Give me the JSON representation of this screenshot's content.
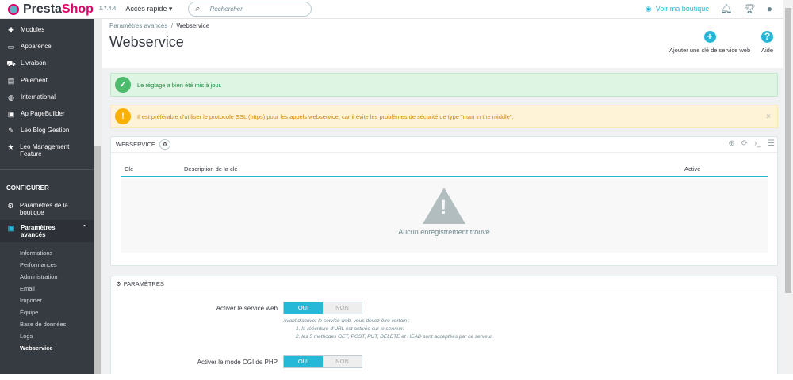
{
  "topbar": {
    "brand_a": "Presta",
    "brand_b": "Shop",
    "version": "1.7.4.4",
    "quick_access": "Accès rapide ▾",
    "search_placeholder": "Rechercher",
    "view_shop": "Voir ma boutique"
  },
  "sidebar": {
    "items": [
      {
        "icon": "✚",
        "label": "Modules"
      },
      {
        "icon": "▭",
        "label": "Apparence"
      },
      {
        "icon": "⛟",
        "label": "Livraison"
      },
      {
        "icon": "▤",
        "label": "Paiement"
      },
      {
        "icon": "◍",
        "label": "International"
      },
      {
        "icon": "▣",
        "label": "Ap PageBuilder"
      },
      {
        "icon": "✎",
        "label": "Leo Blog Gestion"
      },
      {
        "icon": "★",
        "label": "Leo Management Feature"
      }
    ],
    "section": "CONFIGURER",
    "config_items": [
      {
        "icon": "⚙",
        "label": "Paramètres de la boutique"
      },
      {
        "icon": "▣",
        "label": "Paramètres avancés"
      }
    ],
    "sub_items": [
      "Informations",
      "Performances",
      "Administration",
      "Email",
      "Importer",
      "Équipe",
      "Base de données",
      "Logs",
      "Webservice"
    ]
  },
  "header": {
    "breadcrumb_parent": "Paramètres avancés",
    "breadcrumb_sep": "/",
    "breadcrumb_current": "Webservice",
    "title": "Webservice",
    "add_key": "Ajouter une clé de service web",
    "help": "Aide"
  },
  "alerts": {
    "success": "Le réglage a bien été mis à jour.",
    "warning": "Il est préférable d'utiliser le protocole SSL (https) pour les appels webservice, car il évite les problèmes de sécurité de type \"man in the middle\"."
  },
  "table": {
    "title": "WEBSERVICE",
    "count": "0",
    "columns": [
      "Clé",
      "Description de la clé",
      "Activé"
    ],
    "empty": "Aucun enregistrement trouvé"
  },
  "params": {
    "title": "PARAMÈTRES",
    "fields": [
      {
        "label": "Activer le service web",
        "yes": "OUI",
        "no": "NON",
        "value": "OUI",
        "help": [
          "Avant d'activer le service web, vous devez être certain :",
          "1. la réécriture d'URL est activée sur le serveur.",
          "2. les 5 méthodes GET, POST, PUT, DELETE et HEAD sont acceptées par ce serveur."
        ]
      },
      {
        "label": "Activer le mode CGI de PHP",
        "yes": "OUI",
        "no": "NON",
        "value": "OUI"
      }
    ]
  }
}
